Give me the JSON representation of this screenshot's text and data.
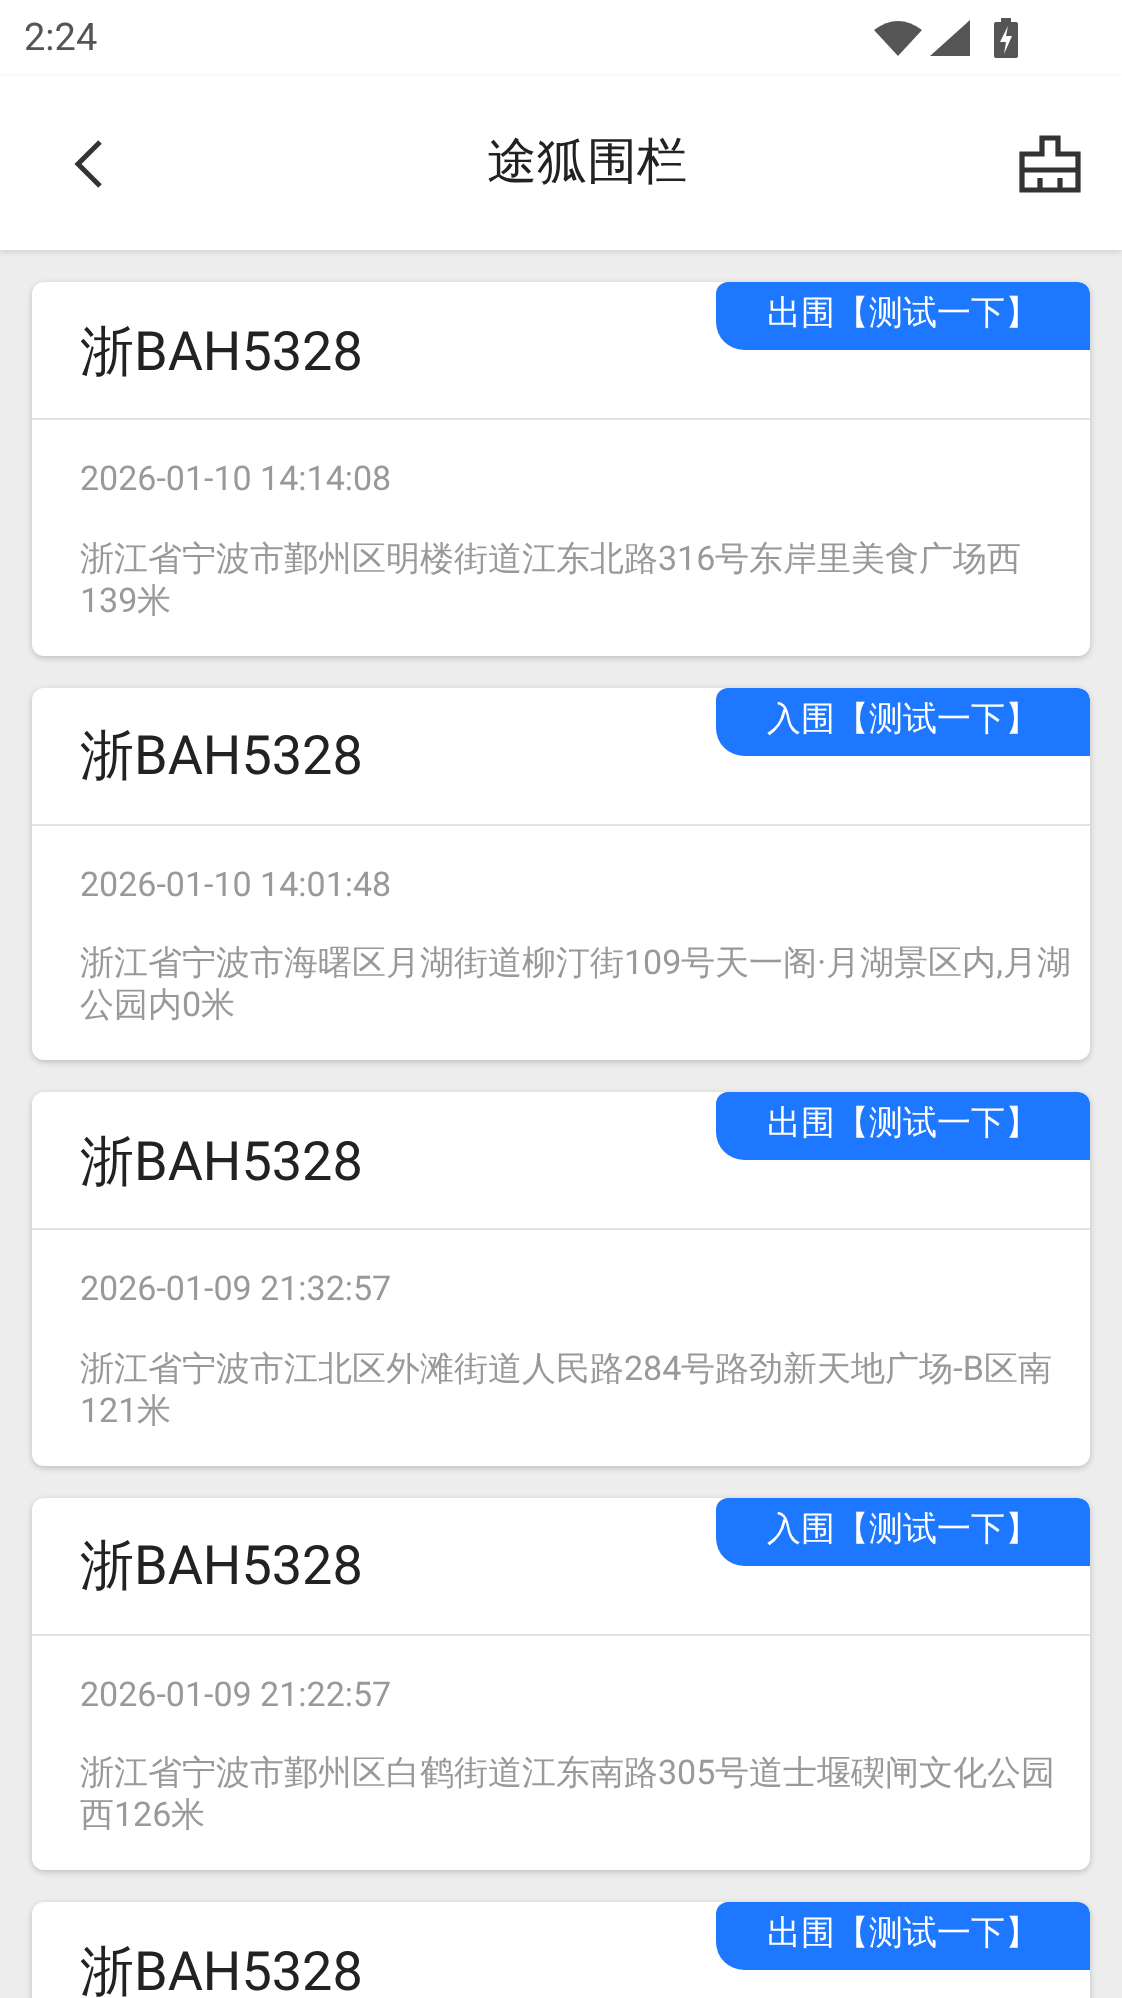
{
  "status_bar": {
    "time": "2:24"
  },
  "header": {
    "title": "途狐围栏"
  },
  "records": [
    {
      "plate": "浙BAH5328",
      "event": "出围【测试一下】",
      "time": "2026-01-10 14:14:08",
      "address": "浙江省宁波市鄞州区明楼街道江东北路316号东岸里美食广场西139米"
    },
    {
      "plate": "浙BAH5328",
      "event": "入围【测试一下】",
      "time": "2026-01-10 14:01:48",
      "address": "浙江省宁波市海曙区月湖街道柳汀街109号天一阁·月湖景区内,月湖公园内0米"
    },
    {
      "plate": "浙BAH5328",
      "event": "出围【测试一下】",
      "time": "2026-01-09 21:32:57",
      "address": "浙江省宁波市江北区外滩街道人民路284号路劲新天地广场-B区南121米"
    },
    {
      "plate": "浙BAH5328",
      "event": "入围【测试一下】",
      "time": "2026-01-09 21:22:57",
      "address": "浙江省宁波市鄞州区白鹤街道江东南路305号道士堰碶闸文化公园西126米"
    },
    {
      "plate": "浙BAH5328",
      "event": "出围【测试一下】"
    }
  ]
}
